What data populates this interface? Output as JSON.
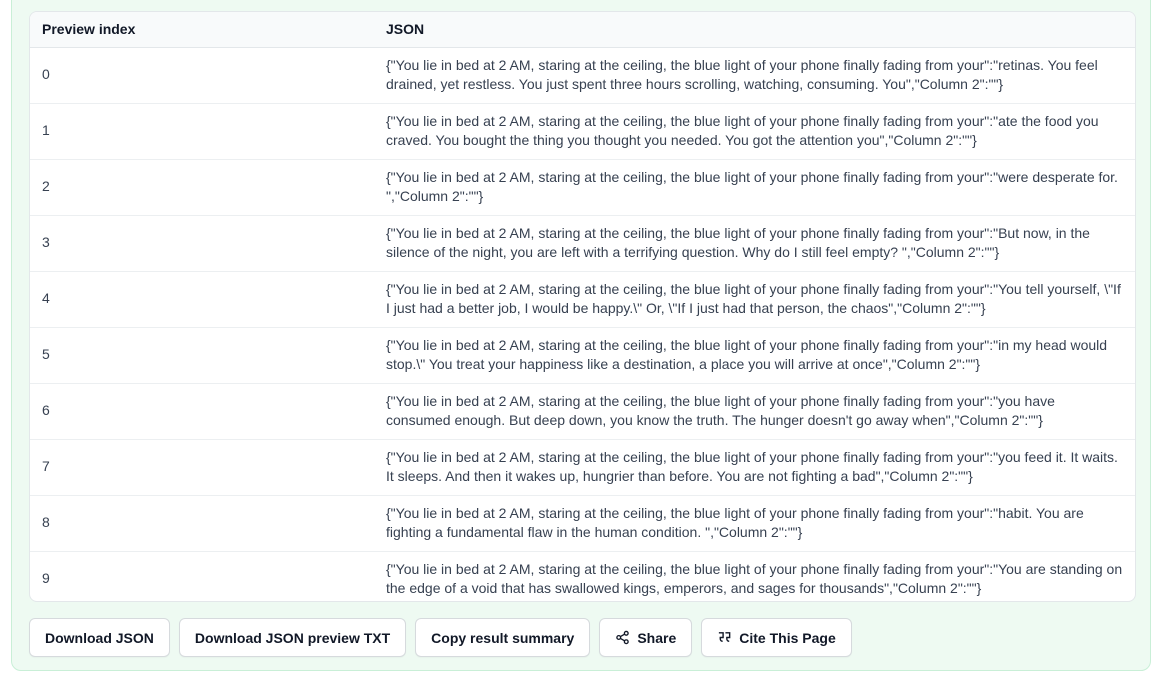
{
  "table": {
    "headers": {
      "index": "Preview index",
      "json": "JSON"
    },
    "rows": [
      {
        "index": "0",
        "json": "{\"You lie in bed at 2 AM, staring at the ceiling, the blue light of your phone finally fading from your\":\"retinas. You feel drained, yet restless. You just spent three hours scrolling, watching, consuming. You\",\"Column 2\":\"\"}"
      },
      {
        "index": "1",
        "json": "{\"You lie in bed at 2 AM, staring at the ceiling, the blue light of your phone finally fading from your\":\"ate the food you craved. You bought the thing you thought you needed. You got the attention you\",\"Column 2\":\"\"}"
      },
      {
        "index": "2",
        "json": "{\"You lie in bed at 2 AM, staring at the ceiling, the blue light of your phone finally fading from your\":\"were desperate for. \",\"Column 2\":\"\"}"
      },
      {
        "index": "3",
        "json": "{\"You lie in bed at 2 AM, staring at the ceiling, the blue light of your phone finally fading from your\":\"But now, in the silence of the night, you are left with a terrifying question. Why do I still feel empty? \",\"Column 2\":\"\"}"
      },
      {
        "index": "4",
        "json": "{\"You lie in bed at 2 AM, staring at the ceiling, the blue light of your phone finally fading from your\":\"You tell yourself, \\\"If I just had a better job, I would be happy.\\\" Or, \\\"If I just had that person, the chaos\",\"Column 2\":\"\"}"
      },
      {
        "index": "5",
        "json": "{\"You lie in bed at 2 AM, staring at the ceiling, the blue light of your phone finally fading from your\":\"in my head would stop.\\\" You treat your happiness like a destination, a place you will arrive at once\",\"Column 2\":\"\"}"
      },
      {
        "index": "6",
        "json": "{\"You lie in bed at 2 AM, staring at the ceiling, the blue light of your phone finally fading from your\":\"you have consumed enough. But deep down, you know the truth. The hunger doesn't go away when\",\"Column 2\":\"\"}"
      },
      {
        "index": "7",
        "json": "{\"You lie in bed at 2 AM, staring at the ceiling, the blue light of your phone finally fading from your\":\"you feed it. It waits. It sleeps. And then it wakes up, hungrier than before. You are not fighting a bad\",\"Column 2\":\"\"}"
      },
      {
        "index": "8",
        "json": "{\"You lie in bed at 2 AM, staring at the ceiling, the blue light of your phone finally fading from your\":\"habit. You are fighting a fundamental flaw in the human condition. \",\"Column 2\":\"\"}"
      },
      {
        "index": "9",
        "json": "{\"You lie in bed at 2 AM, staring at the ceiling, the blue light of your phone finally fading from your\":\"You are standing on the edge of a void that has swallowed kings, emperors, and sages for thousands\",\"Column 2\":\"\"}"
      }
    ]
  },
  "actions": {
    "download_json": "Download JSON",
    "download_txt": "Download JSON preview TXT",
    "copy_summary": "Copy result summary",
    "share": "Share",
    "share_icon": "share-icon",
    "cite": "Cite This Page",
    "cite_icon": "quote-icon"
  }
}
